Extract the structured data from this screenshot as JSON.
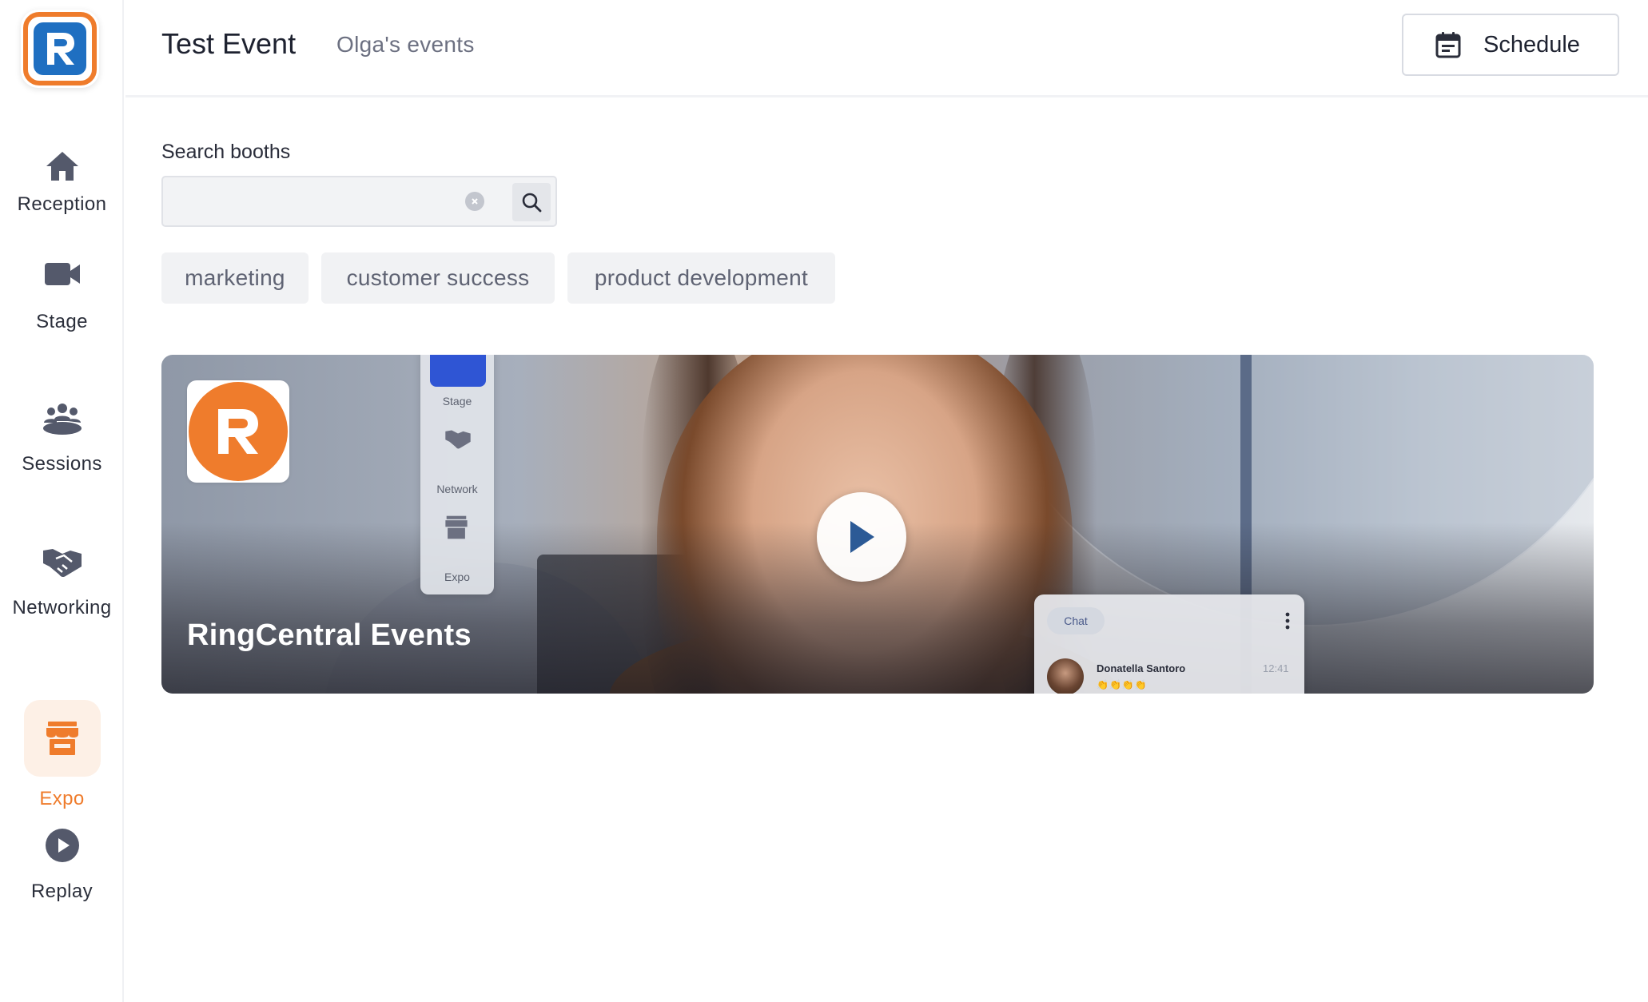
{
  "colors": {
    "accent": "#ef7c2c",
    "logo_blue": "#1f6fc1",
    "sidebar_active_bg": "#fdf0e6",
    "text_primary": "#1e2230",
    "text_muted": "#6c7081"
  },
  "sidebar": {
    "items": [
      {
        "label": "Reception",
        "icon": "home-icon",
        "active": false
      },
      {
        "label": "Stage",
        "icon": "video-camera-icon",
        "active": false
      },
      {
        "label": "Sessions",
        "icon": "group-icon",
        "active": false
      },
      {
        "label": "Networking",
        "icon": "handshake-icon",
        "active": false
      },
      {
        "label": "Expo",
        "icon": "storefront-icon",
        "active": true
      },
      {
        "label": "Replay",
        "icon": "play-circle-icon",
        "active": false
      }
    ]
  },
  "header": {
    "title": "Test Event",
    "owner": "Olga's events",
    "schedule_label": "Schedule"
  },
  "search": {
    "label": "Search booths",
    "value": "",
    "placeholder": ""
  },
  "tags": [
    "marketing",
    "customer success",
    "product development"
  ],
  "booths": [
    {
      "title": "RingCentral Events",
      "mini_nav": [
        "Stage",
        "Network",
        "Expo"
      ],
      "chat": {
        "pill": "Chat",
        "name": "Donatella Santoro",
        "time": "12:41",
        "message": "👏👏👏👏"
      }
    }
  ]
}
